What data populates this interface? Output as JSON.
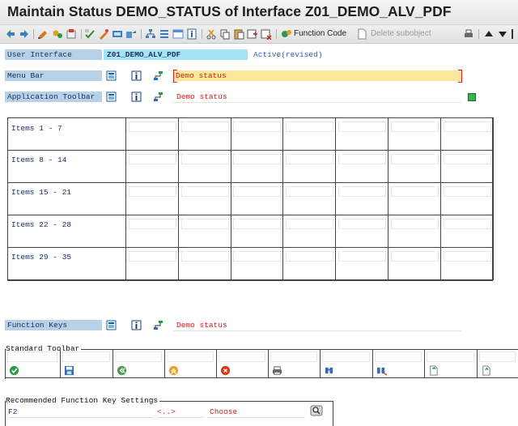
{
  "window": {
    "title": "Maintain Status DEMO_STATUS of Interface Z01_DEMO_ALV_PDF"
  },
  "toolbar": {
    "function_code_label": "Function Code",
    "delete_subobject_label": "Delete subobject"
  },
  "user_interface": {
    "label": "User Interface",
    "value": "Z01_DEMO_ALV_PDF",
    "status": "Active(revised)"
  },
  "menu_bar": {
    "label": "Menu Bar",
    "text": "Demo status"
  },
  "app_toolbar": {
    "label": "Application Toolbar",
    "text": "Demo status"
  },
  "items": {
    "rows": [
      "Items  1 -  7",
      "Items  8 - 14",
      "Items 15 - 21",
      "Items 22 - 28",
      "Items 29 - 35"
    ]
  },
  "function_keys": {
    "label": "Function Keys",
    "text": "Demo status"
  },
  "standard_toolbar": {
    "title": "Standard Toolbar",
    "icons": [
      "check-icon",
      "save-icon",
      "back-icon",
      "exit-icon",
      "cancel-icon",
      "print-icon",
      "find-icon",
      "find-next-icon",
      "first-page-icon",
      "previous-page-icon"
    ]
  },
  "recommended": {
    "title": "Recommended Function Key Settings",
    "key": "F2",
    "placeholder": "<..>",
    "text": "Choose"
  },
  "colors": {
    "accent_blue": "#1d2f66",
    "label_bg": "#b7d2e6",
    "highlight_yellow": "#fbe79a",
    "active_green": "#2fb84a",
    "red_text": "#d4201b"
  }
}
